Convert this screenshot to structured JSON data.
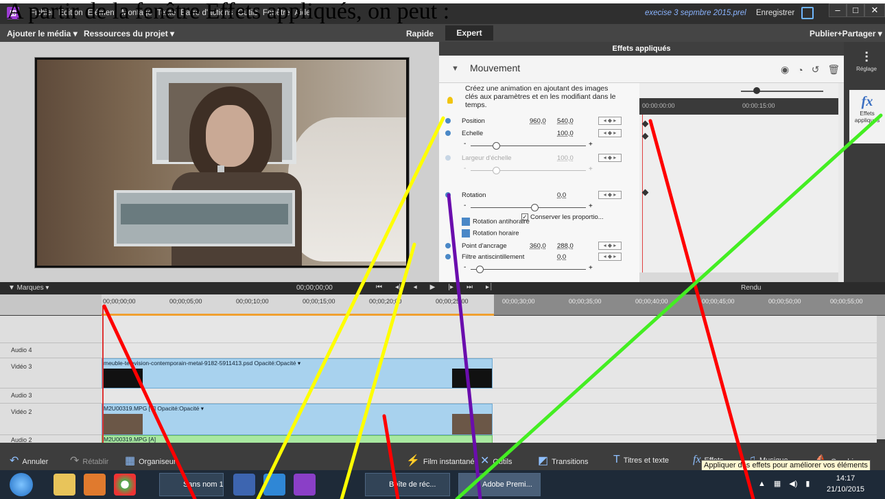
{
  "heading": "A partir de la fenêtre Effets appliqués, on peut :",
  "window": {
    "menu": [
      "Fichier",
      "Edition",
      "Elément",
      "Montage",
      "Texte",
      "Barre d'actions",
      "Outils",
      "Fenêtre",
      "Aide"
    ],
    "filename": "execise 3 sepmbre 2015.prel",
    "save_label": "Enregistrer",
    "minimize": "–",
    "maximize": "□",
    "close": "✕"
  },
  "modebar": {
    "add_media": "Ajouter le média ▾",
    "project_resources": "Ressources du projet ▾",
    "quick": "Rapide",
    "expert": "Expert",
    "publish": "Publier+Partager ▾"
  },
  "effects_panel": {
    "title": "Effets appliqués",
    "section": "Mouvement",
    "help": "Créez une animation en ajoutant des images clés aux paramètres et en les modifiant dans le temps.",
    "timecode_start": "00:00:00:00",
    "timecode_mid": "00:00:15:00",
    "params": [
      {
        "label": "Position",
        "v1": "960,0",
        "v2": "540,0"
      },
      {
        "label": "Echelle",
        "v1": "",
        "v2": "100,0"
      },
      {
        "label": "Largeur d'échelle",
        "v1": "",
        "v2": "100,0"
      },
      {
        "label": "Rotation",
        "v1": "",
        "v2": "0,0"
      },
      {
        "label": "Point d'ancrage",
        "v1": "360,0",
        "v2": "288,0"
      },
      {
        "label": "Filtre antiscintillement",
        "v1": "",
        "v2": "0,0"
      }
    ],
    "keep_proportions": "Conserver les proportio...",
    "rotate_ccw": "Rotation antihoraire",
    "rotate_cw": "Rotation horaire",
    "kf_nav": "◂ ◆ ▸",
    "slider_levels": {
      "scale": 0.2,
      "width": 0.2,
      "rotation": 0.55,
      "flicker": 0.05
    }
  },
  "sidebar": {
    "adjust_label": "Réglage",
    "applied_label": "Effets appliqués"
  },
  "timeline": {
    "marks": "▼ Marques  ▾",
    "timecode": "00;00;00;00",
    "render": "Rendu",
    "ticks": [
      "00;00;00;00",
      "00;00;05;00",
      "00;00;10;00",
      "00;00;15;00",
      "00;00;20;00",
      "00;00;25;00",
      "00;00;30;00",
      "00;00;35;00",
      "00;00;40;00",
      "00;00;45;00",
      "00;00;50;00",
      "00;00;55;00"
    ],
    "tracks": [
      {
        "name": "Audio 4"
      },
      {
        "name": "Vidéo 3"
      },
      {
        "name": "Audio 3"
      },
      {
        "name": "Vidéo 2"
      },
      {
        "name": "Audio 2"
      }
    ],
    "clip_v3": "meuble-television-contemporain-metal-9182-5911413.psd  Opacité:Opacité ▾",
    "clip_v2": "M2U00319.MPG [V]  Opacité:Opacité ▾",
    "clip_a2": "M2U00319.MPG [A]"
  },
  "actions": {
    "undo": "Annuler",
    "redo": "Rétablir",
    "organizer": "Organiseur",
    "instant_movie": "Film instantané",
    "tools": "Outils",
    "transitions": "Transitions",
    "titles": "Titres et texte",
    "effects": "Effets",
    "music": "Musique",
    "graphics": "Graphiques",
    "tooltip": "Appliquer des effets pour améliorer vos éléments"
  },
  "taskbar": {
    "task1": "Sans nom 1 -...",
    "task2": "Boîte de réc...",
    "task3": "Adobe Premi...",
    "time": "14:17",
    "date": "21/10/2015"
  },
  "overlay_colors": {
    "red": "#ff0000",
    "yellow": "#ffff00",
    "purple": "#6a0dad",
    "green": "#44ee22"
  }
}
